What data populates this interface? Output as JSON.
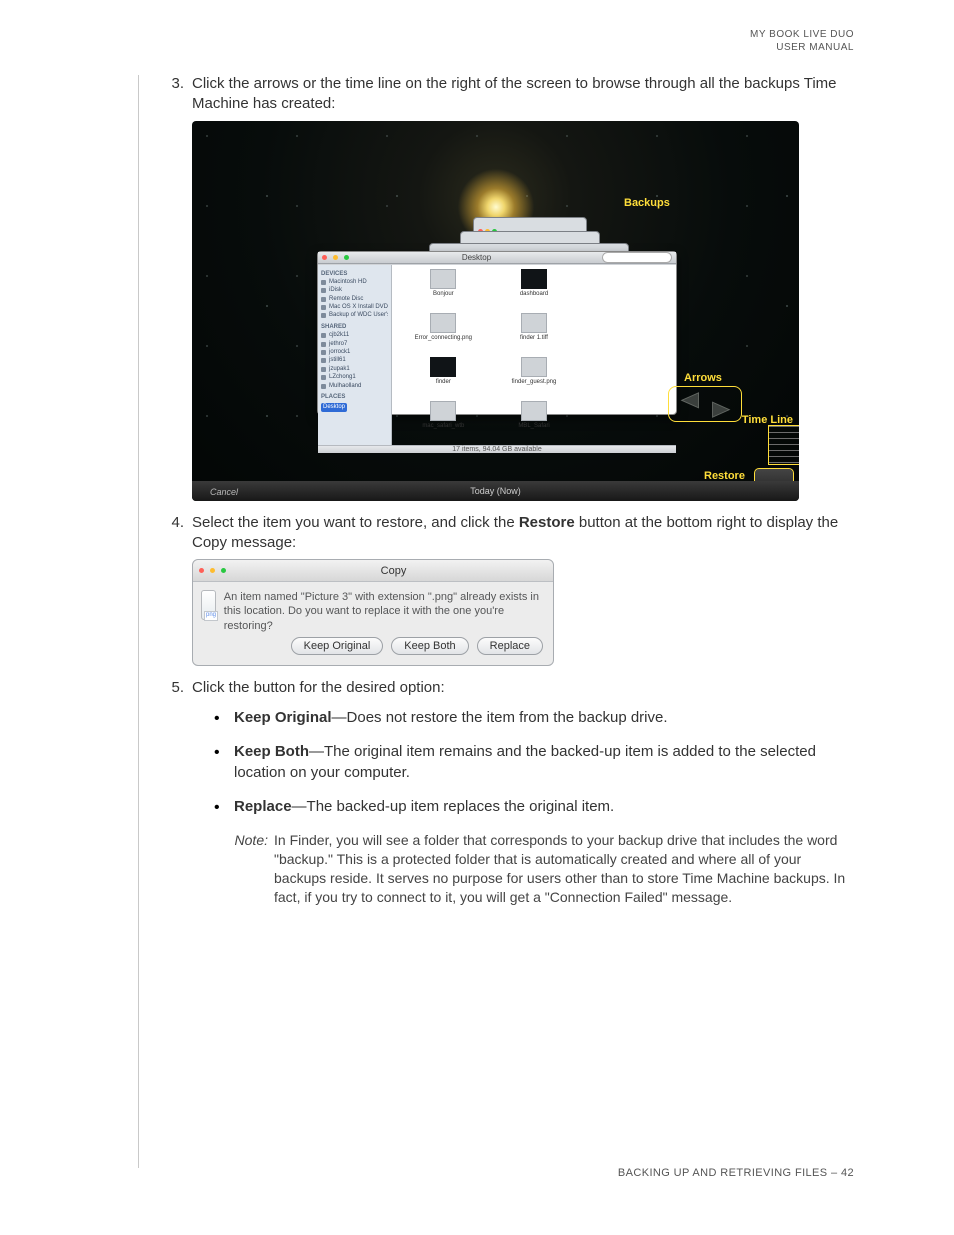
{
  "header": {
    "line1": "MY BOOK LIVE DUO",
    "line2": "USER MANUAL"
  },
  "steps": {
    "s3": {
      "num": "3.",
      "text_a": "Click the arrows or the time line on the right of the screen to browse through all the backups Time Machine has created:"
    },
    "s4": {
      "num": "4.",
      "text_a": "Select the item you want to restore, and click the ",
      "bold": "Restore",
      "text_b": " button at the bottom right to display the Copy message:"
    },
    "s5": {
      "num": "5.",
      "text_a": "Click the button for the desired option:"
    }
  },
  "tm": {
    "backups": "Backups",
    "arrows": "Arrows",
    "timeline": "Time Line",
    "restore": "Restore\nButton",
    "today": "Today (Now)",
    "cancel": "Cancel",
    "finder": {
      "title": "Desktop",
      "status": "17 items, 94.04 GB available",
      "devices_label": "DEVICES",
      "devices": [
        "Macintosh HD",
        "iDisk",
        "Remote Disc",
        "Mac OS X Install DVD",
        "Backup of WDC User's Mac mini"
      ],
      "shared_label": "SHARED",
      "shared": [
        "cjb2k11",
        "jethro7",
        "jorrock1",
        "jstill61",
        "jzupak1",
        "LZchong1",
        "Mulhaolland"
      ],
      "places_label": "PLACES",
      "places_selected": "Desktop",
      "files": [
        "Bonjour",
        "dashboard",
        "Error_connecting.png",
        "finder 1.tiff",
        "finder",
        "finder_guest.png",
        "mac_safari_wtb",
        "MBL_Safari"
      ]
    }
  },
  "copy": {
    "title": "Copy",
    "message": "An item named \"Picture 3\" with extension \".png\" already exists in this location. Do you want to replace it with the one you're restoring?",
    "btn_keep_original": "Keep Original",
    "btn_keep_both": "Keep Both",
    "btn_replace": "Replace"
  },
  "bullets": {
    "b1_bold": "Keep Original",
    "b1_rest": "—Does not restore the item from the backup drive.",
    "b2_bold": "Keep Both",
    "b2_rest": "—The original item remains and the backed-up item is added to the selected location on your computer.",
    "b3_bold": "Replace",
    "b3_rest": "—The backed-up item replaces the original item."
  },
  "note": {
    "label": "Note:",
    "text": "In Finder, you will see a folder that corresponds to your backup drive that includes the word \"backup.\" This is a protected folder that is automatically created and where all of your backups reside. It serves no purpose for users other than to store Time Machine backups. In fact, if you try to connect to it, you will get a \"Connection Failed\" message."
  },
  "footer": "BACKING UP AND RETRIEVING FILES – 42"
}
